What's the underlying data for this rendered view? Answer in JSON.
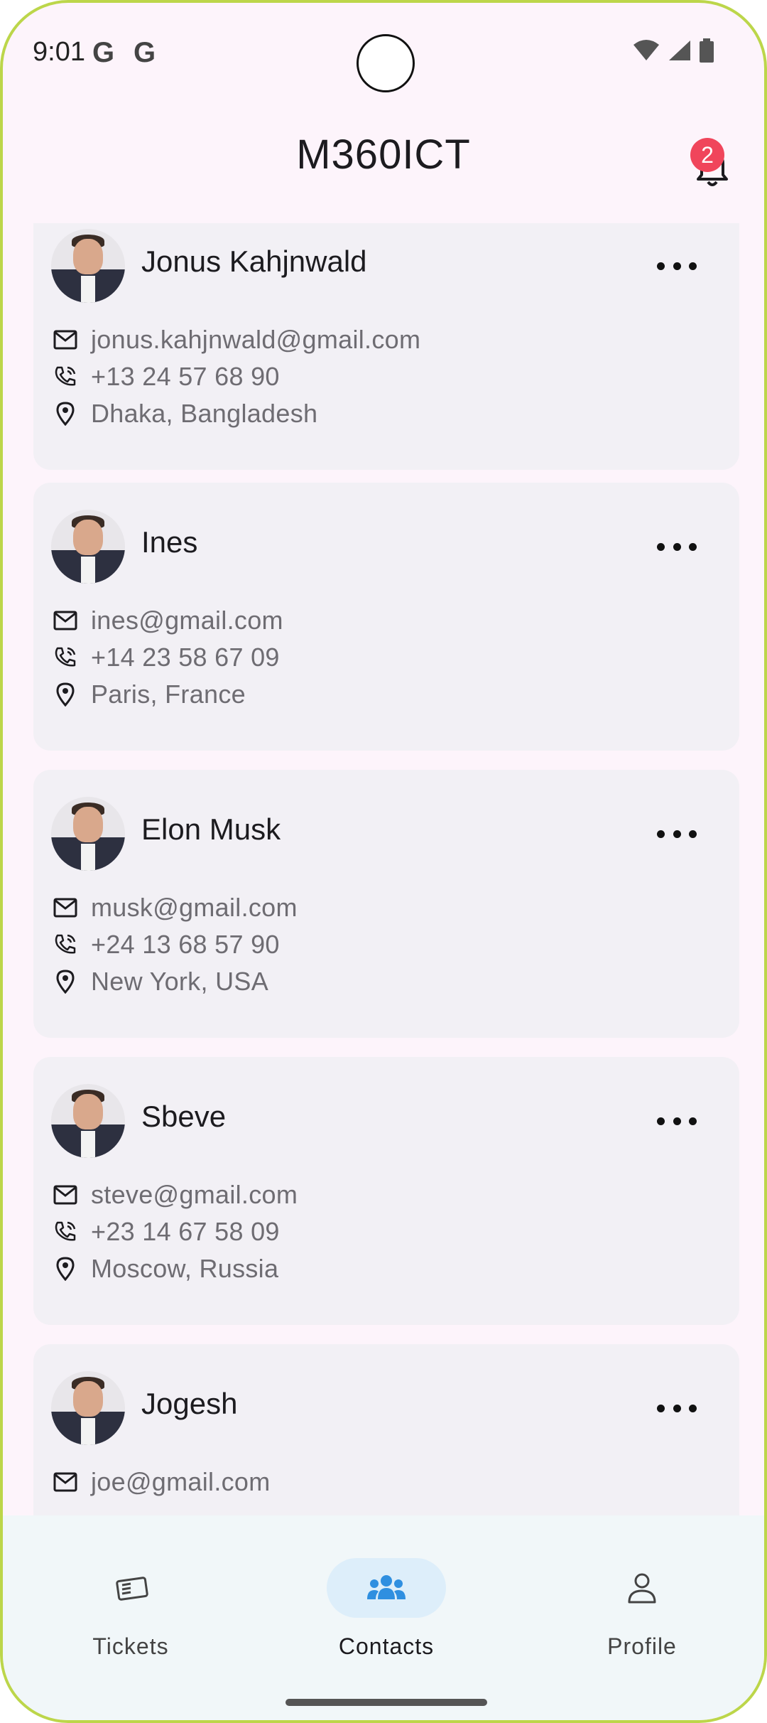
{
  "status_bar": {
    "time": "9:01",
    "g_glyph": "G"
  },
  "app_bar": {
    "title": "M360ICT",
    "notification_count": "2"
  },
  "contacts": [
    {
      "name": "Jonus Kahjnwald",
      "email": "jonus.kahjnwald@gmail.com",
      "phone": "+13 24 57 68 90",
      "location": "Dhaka, Bangladesh"
    },
    {
      "name": "Ines",
      "email": "ines@gmail.com",
      "phone": "+14 23 58 67 09",
      "location": "Paris, France"
    },
    {
      "name": "Elon Musk",
      "email": "musk@gmail.com",
      "phone": "+24 13 68 57 90",
      "location": "New York, USA"
    },
    {
      "name": "Sbeve",
      "email": "steve@gmail.com",
      "phone": "+23 14 67 58 09",
      "location": "Moscow, Russia"
    },
    {
      "name": "Jogesh",
      "email": "joe@gmail.com",
      "phone": "",
      "location": ""
    }
  ],
  "bottom_nav": {
    "items": [
      {
        "label": "Tickets",
        "icon": "ticket-icon",
        "active": false
      },
      {
        "label": "Contacts",
        "icon": "group-icon",
        "active": true
      },
      {
        "label": "Profile",
        "icon": "person-icon",
        "active": false
      }
    ]
  },
  "colors": {
    "accent": "#2f8fe0",
    "badge": "#f0455b",
    "card": "#f2f0f5",
    "background": "#fdf4fb"
  }
}
